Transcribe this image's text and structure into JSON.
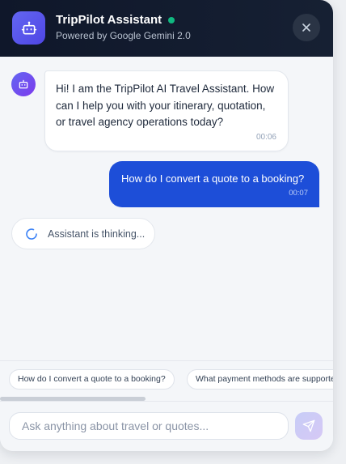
{
  "header": {
    "title": "TripPilot Assistant",
    "subtitle": "Powered by Google Gemini 2.0",
    "status": "online",
    "status_color": "#10b981",
    "avatar_icon": "robot-icon",
    "close_icon": "close-icon"
  },
  "messages": [
    {
      "sender": "assistant",
      "text": "Hi! I am the TripPilot AI Travel Assistant. How can I help you with your itinerary, quotation, or travel agency operations today?",
      "time": "00:06"
    },
    {
      "sender": "user",
      "text": "How do I convert a quote to a booking?",
      "time": "00:07"
    }
  ],
  "thinking": {
    "text": "Assistant is thinking...",
    "icon": "spinner-icon"
  },
  "suggestions": [
    "How do I convert a quote to a booking?",
    "What payment methods are supported?"
  ],
  "input": {
    "placeholder": "Ask anything about travel or quotes...",
    "value": "",
    "send_icon": "send-icon"
  },
  "colors": {
    "header_bg": "#0f172a",
    "accent": "#4f46e5",
    "user_bubble": "#1d4ed8"
  }
}
